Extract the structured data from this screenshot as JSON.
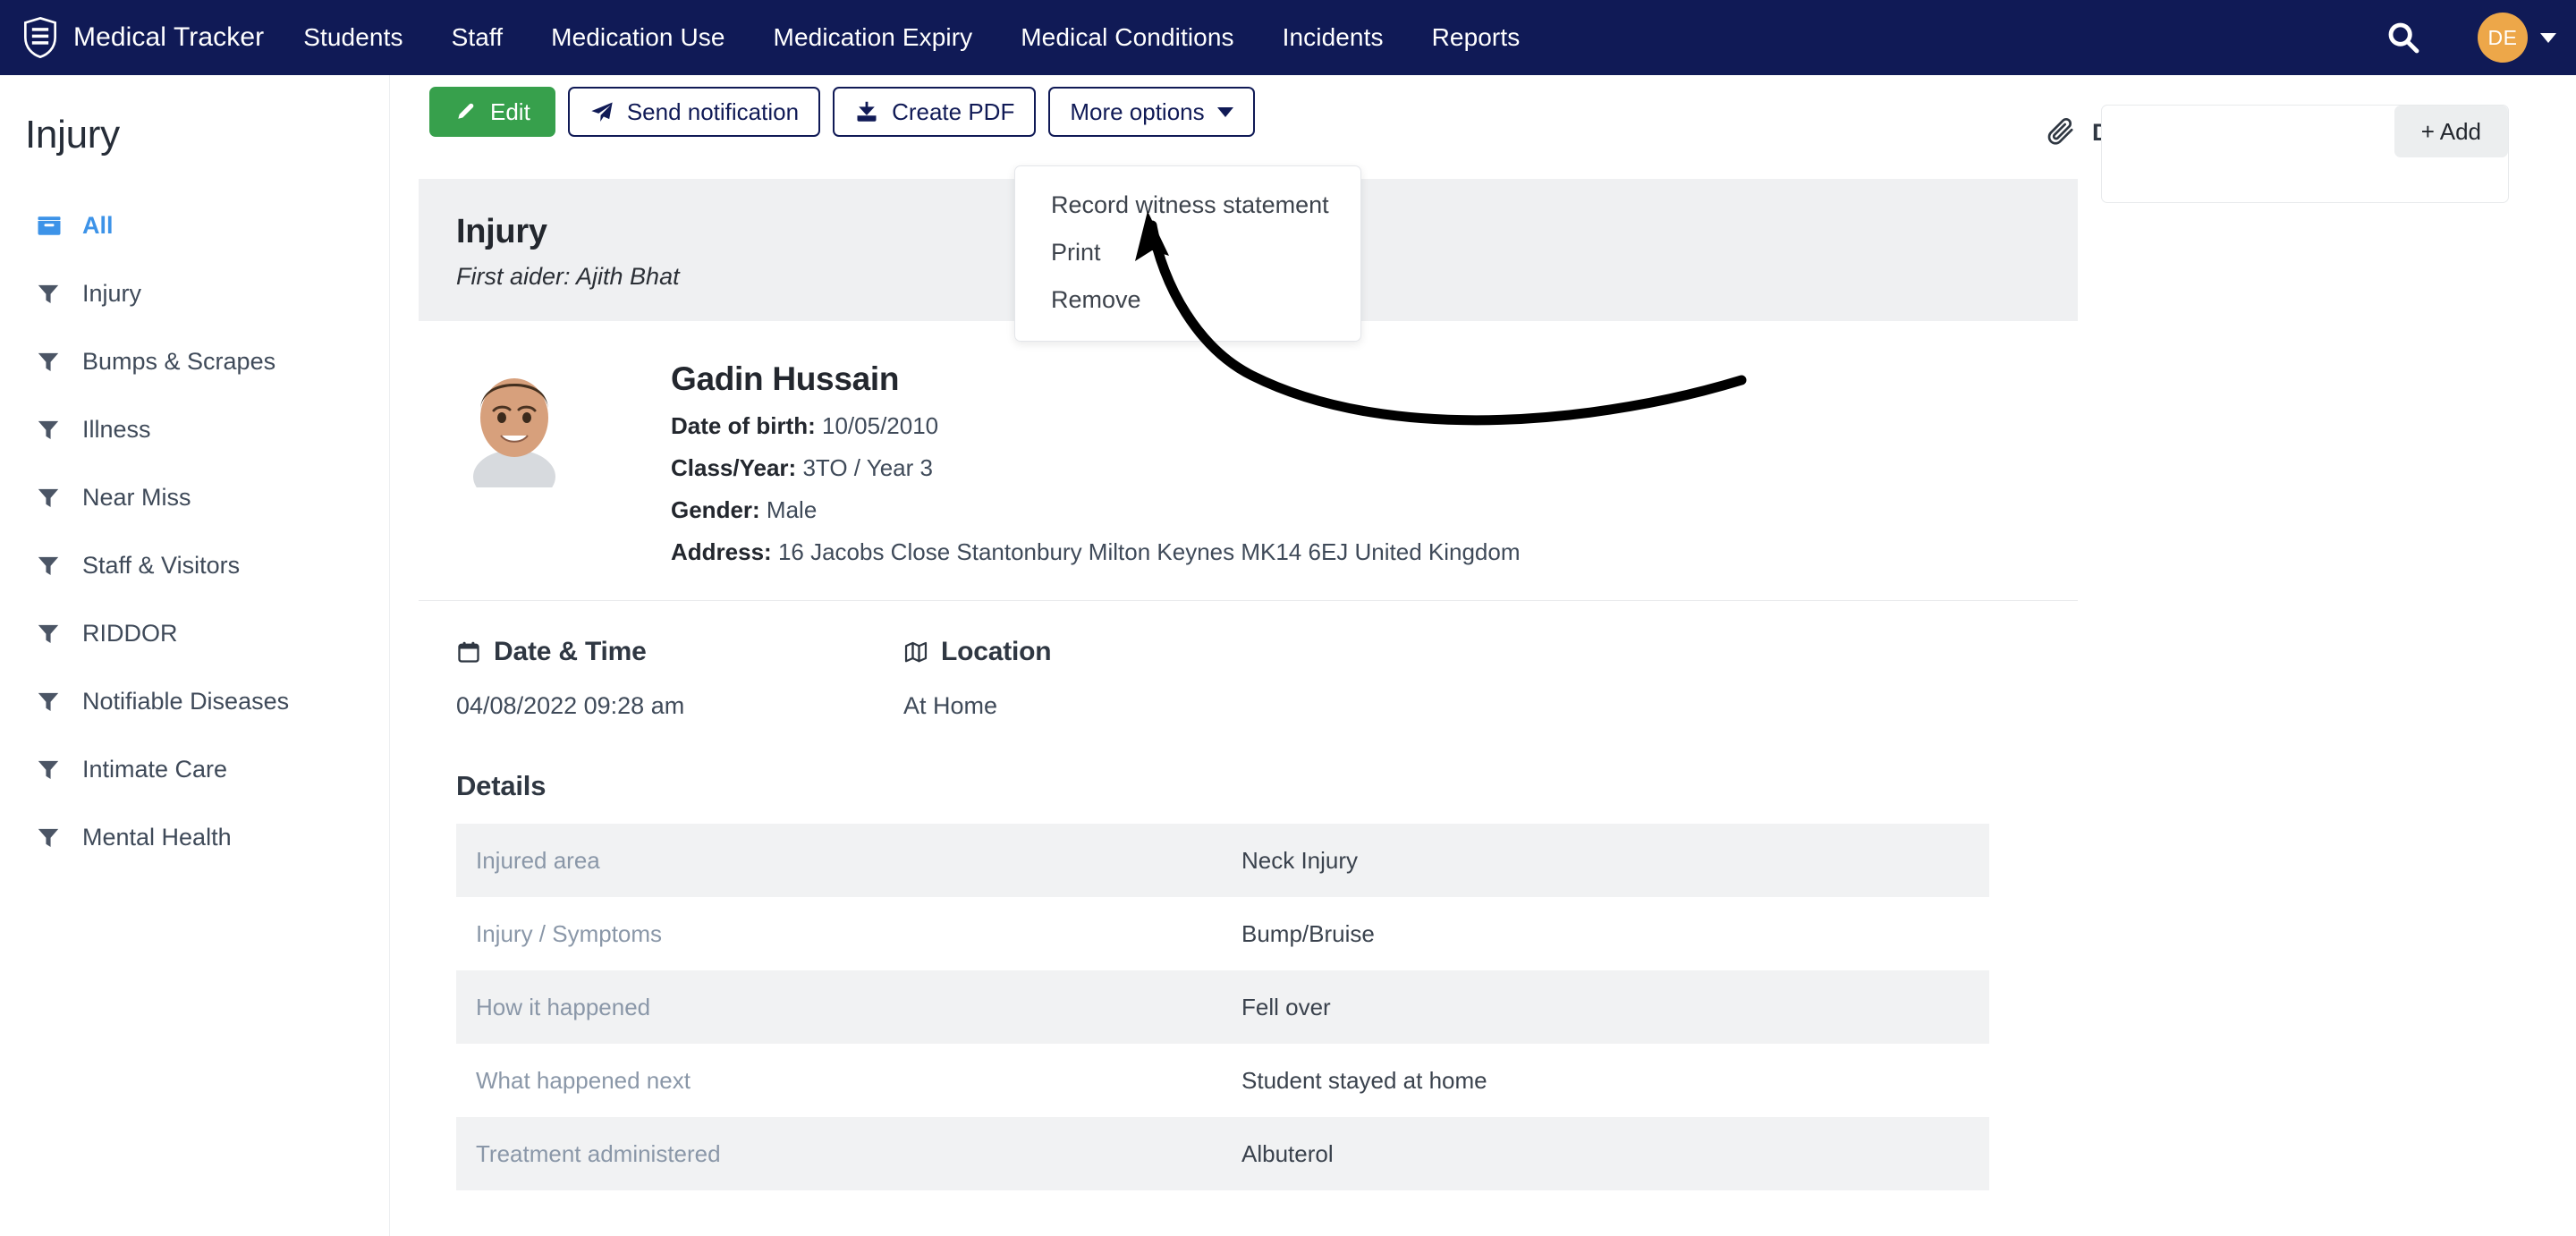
{
  "topnav": {
    "brand": "Medical Tracker",
    "logo_icon": "shield-lines-icon",
    "links": [
      "Students",
      "Staff",
      "Medication Use",
      "Medication Expiry",
      "Medical Conditions",
      "Incidents",
      "Reports"
    ],
    "search_icon": "search-icon",
    "avatar_initials": "DE",
    "avatar_color": "#eda749",
    "bar_color": "#101a56"
  },
  "sidebar": {
    "title": "Injury",
    "items": [
      {
        "label": "All",
        "icon": "inbox-icon",
        "active": true
      },
      {
        "label": "Injury",
        "icon": "filter-icon",
        "active": false
      },
      {
        "label": "Bumps & Scrapes",
        "icon": "filter-icon",
        "active": false
      },
      {
        "label": "Illness",
        "icon": "filter-icon",
        "active": false
      },
      {
        "label": "Near Miss",
        "icon": "filter-icon",
        "active": false
      },
      {
        "label": "Staff & Visitors",
        "icon": "filter-icon",
        "active": false
      },
      {
        "label": "RIDDOR",
        "icon": "filter-icon",
        "active": false
      },
      {
        "label": "Notifiable Diseases",
        "icon": "filter-icon",
        "active": false
      },
      {
        "label": "Intimate Care",
        "icon": "filter-icon",
        "active": false
      },
      {
        "label": "Mental Health",
        "icon": "filter-icon",
        "active": false
      }
    ],
    "active_color": "#3d93e8"
  },
  "toolbar": {
    "edit_label": "Edit",
    "edit_icon": "pencil-icon",
    "edit_color": "#37a04c",
    "send_label": "Send notification",
    "send_icon": "paper-plane-icon",
    "pdf_label": "Create PDF",
    "pdf_icon": "download-icon",
    "more_label": "More options",
    "more_caret_icon": "chevron-down-icon"
  },
  "dropdown": {
    "open": true,
    "items": [
      "Record witness statement",
      "Print",
      "Remove"
    ]
  },
  "record": {
    "header_title": "Injury",
    "header_subtitle": "First aider: Ajith Bhat",
    "person": {
      "photo_alt": "student-photo",
      "name": "Gadin Hussain",
      "fields": [
        {
          "label": "Date of birth:",
          "value": "10/05/2010"
        },
        {
          "label": "Class/Year:",
          "value": "3TO / Year 3"
        },
        {
          "label": "Gender:",
          "value": "Male"
        },
        {
          "label": "Address:",
          "value": "16 Jacobs Close Stantonbury Milton Keynes MK14 6EJ United Kingdom"
        }
      ]
    },
    "datetime": {
      "title": "Date & Time",
      "icon": "calendar-icon",
      "value": "04/08/2022 09:28 am"
    },
    "location": {
      "title": "Location",
      "icon": "map-icon",
      "value": "At Home"
    },
    "details": {
      "title": "Details",
      "rows": [
        {
          "label": "Injured area",
          "value": "Neck Injury"
        },
        {
          "label": "Injury / Symptoms",
          "value": "Bump/Bruise"
        },
        {
          "label": "How it happened",
          "value": "Fell over"
        },
        {
          "label": "What happened next",
          "value": "Student stayed at home"
        },
        {
          "label": "Treatment administered",
          "value": "Albuterol"
        }
      ]
    }
  },
  "documents": {
    "title": "Documents",
    "icon": "paperclip-icon",
    "add_label": "+ Add"
  },
  "annotation": {
    "type": "curved-arrow",
    "color": "#000000",
    "points_to": "Record witness statement"
  }
}
